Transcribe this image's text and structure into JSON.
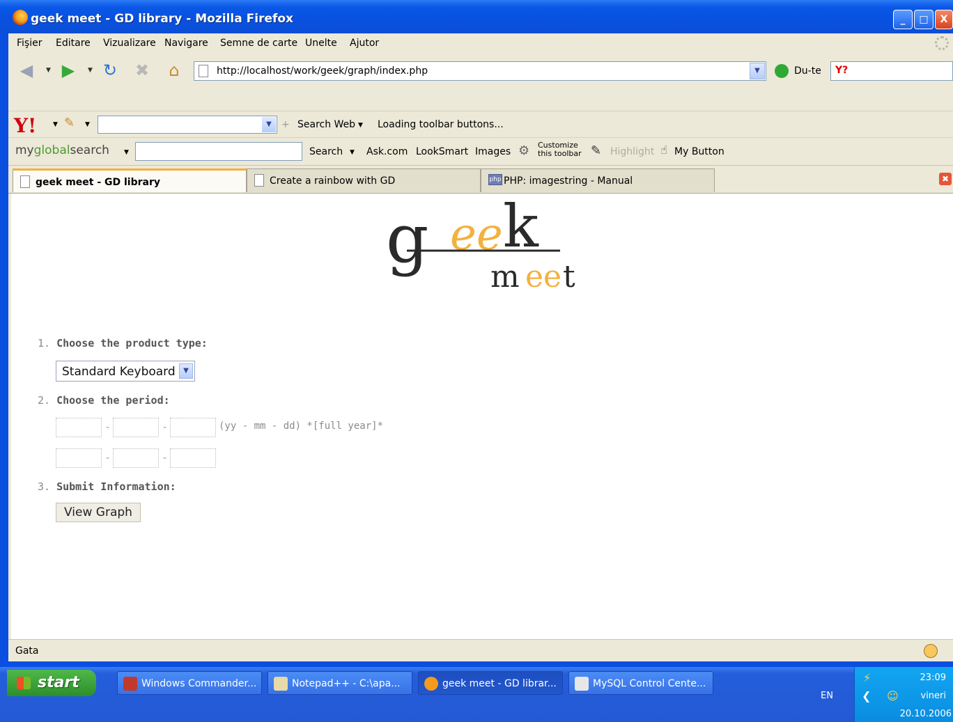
{
  "window": {
    "title": "geek meet - GD library - Mozilla Firefox",
    "controls": [
      "_",
      "□",
      "X"
    ]
  },
  "menu": [
    "Fişier",
    "Editare",
    "Vizualizare",
    "Navigare",
    "Semne de carte",
    "Unelte",
    "Ajutor"
  ],
  "nav": {
    "url": "http://localhost/work/geek/graph/index.php",
    "go_label": "Du-te",
    "yahoo_box": "Y?"
  },
  "yahoo_toolbar": {
    "logo": "Y!",
    "search_web": "Search Web",
    "loading": "Loading toolbar buttons..."
  },
  "mgs_toolbar": {
    "brand_a": "my",
    "brand_b": "global",
    "brand_c": "search",
    "search": "Search",
    "ask": "Ask.com",
    "looksmart": "LookSmart",
    "images": "Images",
    "customize_1": "Customize",
    "customize_2": "this toolbar",
    "highlight": "Highlight",
    "my_button": "My Button"
  },
  "tabs": [
    {
      "label": "geek meet - GD library",
      "active": true
    },
    {
      "label": "Create a rainbow with GD",
      "active": false
    },
    {
      "label": "PHP: imagestring - Manual",
      "active": false,
      "icon_text": "php"
    }
  ],
  "logo": {
    "word1": "geek",
    "word2": "meet",
    "accent": "#f3b13f"
  },
  "form": {
    "step1": {
      "num": "1.",
      "label": "Choose the product type:"
    },
    "product_selected": "Standard Keyboard",
    "step2": {
      "num": "2.",
      "label": "Choose the period:"
    },
    "date_hint": "(yy - mm - dd) *[full year]*",
    "date_sep": "-",
    "step3": {
      "num": "3.",
      "label": "Submit Information:"
    },
    "submit": "View Graph"
  },
  "status": {
    "text": "Gata"
  },
  "taskbar": {
    "start": "start",
    "tasks": [
      {
        "label": "Windows Commander...",
        "color": "#c0392b"
      },
      {
        "label": "Notepad++ - C:\\apa...",
        "color": "#e8d9a8"
      },
      {
        "label": "geek meet - GD librar...",
        "color": "#f49a1c",
        "active": true
      },
      {
        "label": "MySQL Control Cente...",
        "color": "#e7e7e7"
      }
    ],
    "lang": "EN",
    "time": "23:09",
    "day": "vineri",
    "date": "20.10.2006"
  }
}
